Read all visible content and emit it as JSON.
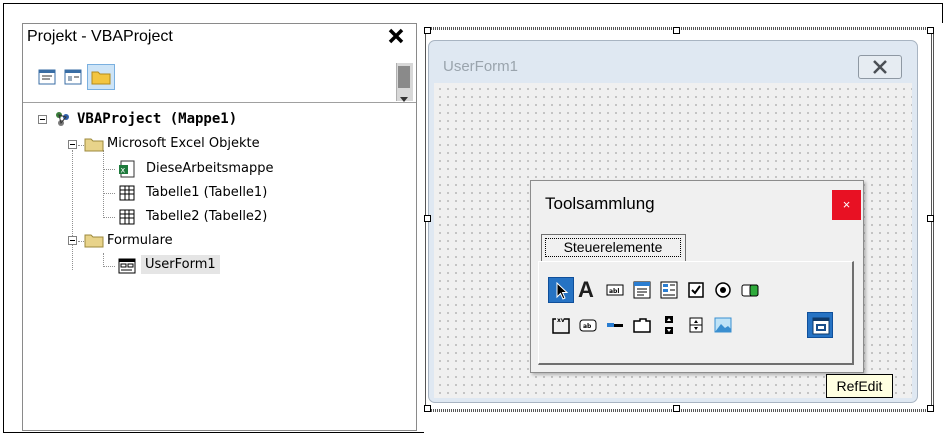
{
  "project_explorer": {
    "title": "Projekt - VBAProject",
    "close_symbol": "✕",
    "toolbar": [
      "view-code-icon",
      "view-object-icon",
      "toggle-folders-icon"
    ],
    "tree": {
      "root": "VBAProject (Mappe1)",
      "excel_folder": "Microsoft Excel Objekte",
      "items": [
        "DieseArbeitsmappe",
        "Tabelle1 (Tabelle1)",
        "Tabelle2 (Tabelle2)"
      ],
      "forms_folder": "Formulare",
      "form_item": "UserForm1"
    }
  },
  "designer": {
    "userform_title": "UserForm1",
    "userform_close": "✕"
  },
  "toolbox": {
    "title": "Toolsammlung",
    "close": "×",
    "tab": "Steuerelemente",
    "tools_row1": [
      "pointer-icon",
      "label-icon",
      "textbox-icon",
      "combobox-icon",
      "listbox-icon",
      "checkbox-icon",
      "optionbutton-icon",
      "togglebutton-icon"
    ],
    "tools_row2": [
      "frame-icon",
      "commandbutton-icon",
      "tabstrip-icon",
      "multipage-icon",
      "scrollbar-icon",
      "spinbutton-icon",
      "image-icon",
      "refedit-icon"
    ],
    "label_glyph": "A",
    "tooltip": "RefEdit",
    "accent": "#2673c4",
    "close_color": "#e81123"
  }
}
